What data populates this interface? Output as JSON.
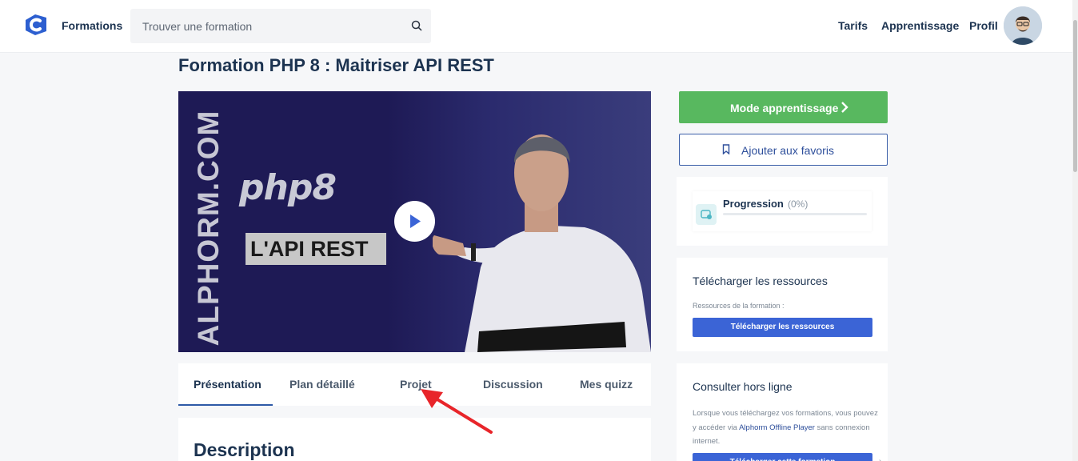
{
  "header": {
    "nav_formations": "Formations",
    "search_placeholder": "Trouver une formation",
    "nav_tarifs": "Tarifs",
    "nav_apprentissage": "Apprentissage",
    "nav_profil": "Profil"
  },
  "page_title": "Formation PHP 8 : Maitriser API REST",
  "video": {
    "brand_vertical": "ALPHORM.COM",
    "php_logo": "php8",
    "badge": "L'API REST"
  },
  "tabs": [
    {
      "label": "Présentation",
      "active": true
    },
    {
      "label": "Plan détaillé",
      "active": false
    },
    {
      "label": "Projet",
      "active": false
    },
    {
      "label": "Discussion",
      "active": false
    },
    {
      "label": "Mes quizz",
      "active": false
    }
  ],
  "description_title": "Description",
  "sidebar": {
    "mode_button": "Mode apprentissage",
    "favorites_button": "Ajouter aux favoris",
    "progress_label": "Progression",
    "progress_pct": "(0%)",
    "progress_value": 0,
    "resources_title": "Télécharger les ressources",
    "resources_sub": "Ressources de la formation :",
    "resources_button": "Télécharger les ressources",
    "offline_title": "Consulter hors ligne",
    "offline_text_1": "Lorsque vous téléchargez vos formations, vous pouvez y accéder via ",
    "offline_link": "Alphorm Offline Player",
    "offline_text_2": " sans connexion internet.",
    "offline_button": "Télécharger cette formation"
  },
  "colors": {
    "accent_green": "#58b85f",
    "accent_blue": "#3b64d6",
    "navy": "#1c3350",
    "arrow_red": "#e8252a"
  }
}
